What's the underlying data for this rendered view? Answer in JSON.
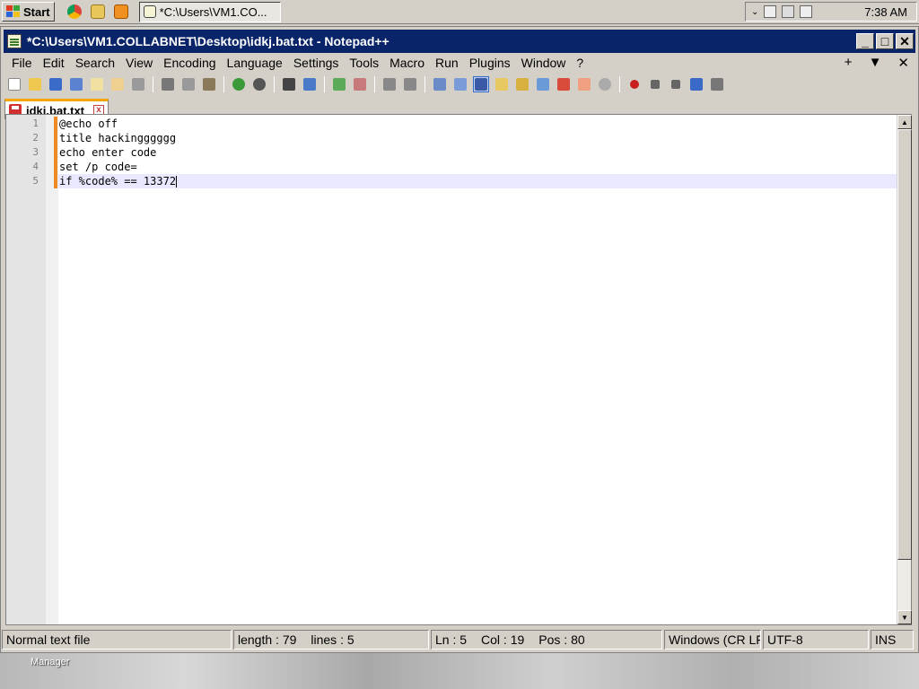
{
  "taskbar": {
    "start_label": "Start",
    "task_button_label": "*C:\\Users\\VM1.CO...",
    "clock": "7:38 AM"
  },
  "window": {
    "title": "*C:\\Users\\VM1.COLLABNET\\Desktop\\idkj.bat.txt - Notepad++",
    "controls": {
      "minimize": "_",
      "maximize": "□",
      "close": "✕"
    }
  },
  "menu": {
    "items": [
      "File",
      "Edit",
      "Search",
      "View",
      "Encoding",
      "Language",
      "Settings",
      "Tools",
      "Macro",
      "Run",
      "Plugins",
      "Window",
      "?"
    ],
    "right": {
      "plus": "+",
      "down": "▼",
      "close": "✕"
    }
  },
  "tab": {
    "label": "idkj.bat.txt",
    "close": "x"
  },
  "editor": {
    "line_numbers": [
      "1",
      "2",
      "3",
      "4",
      "5"
    ],
    "lines": [
      "@echo off",
      "title hackingggggg",
      "echo enter code",
      "set /p code=",
      "if %code% == 13372"
    ]
  },
  "status": {
    "file_type": "Normal text file",
    "length": "length : 79",
    "lines": "lines : 5",
    "ln": "Ln : 5",
    "col": "Col : 19",
    "pos": "Pos : 80",
    "eol": "Windows (CR LF)",
    "encoding": "UTF-8",
    "mode": "INS"
  },
  "desktop": {
    "label": "Manager"
  },
  "colors": {
    "title_bar": "#0a246a",
    "tab_accent": "#f7a500",
    "change_marker": "#f08a24",
    "current_line": "#e8e8ff"
  },
  "icons": {
    "toolbar": [
      "new-file-icon",
      "open-file-icon",
      "save-icon",
      "save-all-icon",
      "close-icon",
      "close-all-icon",
      "print-icon",
      "cut-icon",
      "copy-icon",
      "paste-icon",
      "undo-icon",
      "redo-icon",
      "find-icon",
      "replace-icon",
      "zoom-in-icon",
      "zoom-out-icon",
      "sync-vertical-icon",
      "sync-horizontal-icon",
      "word-wrap-icon",
      "show-all-chars-icon",
      "indent-guide-icon",
      "doc-map-icon",
      "function-list-icon",
      "folder-workspace-icon",
      "monitoring-icon",
      "record-macro-icon",
      "stop-macro-icon",
      "play-macro-icon",
      "run-macro-multiple-icon",
      "save-macro-icon"
    ]
  }
}
